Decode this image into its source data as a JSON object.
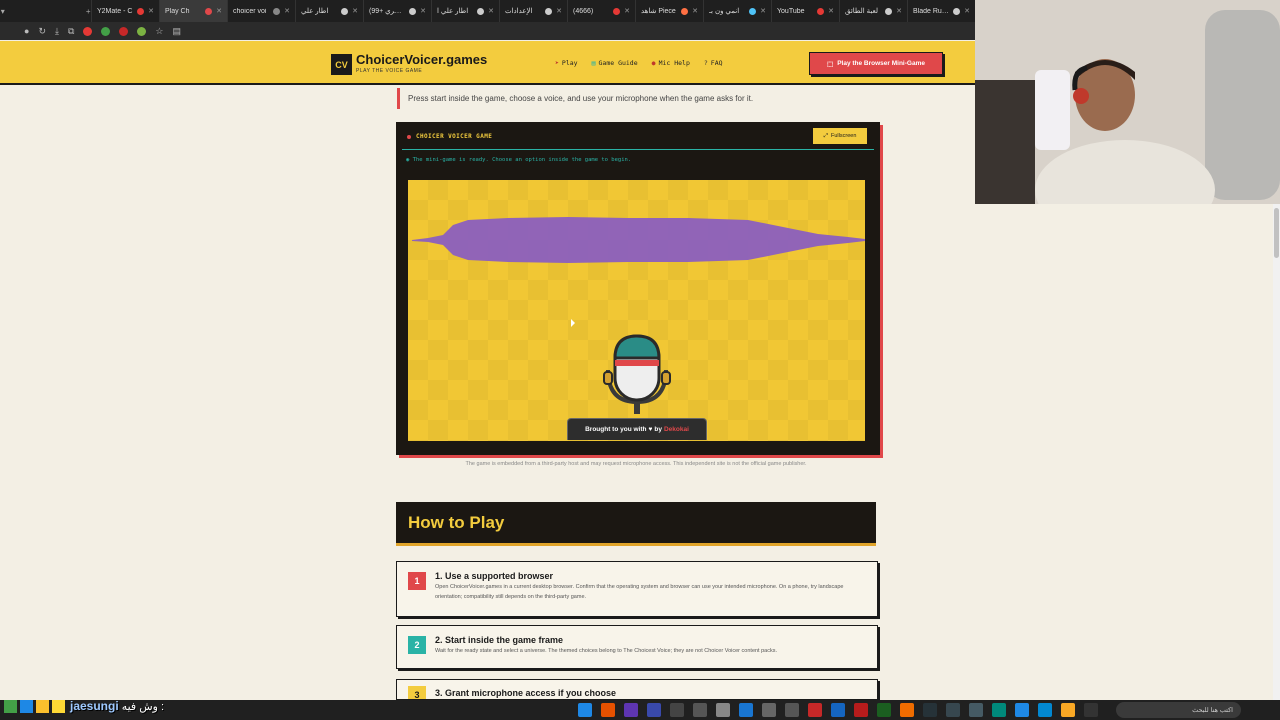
{
  "browser": {
    "tabs": [
      {
        "title": "Y2Mate - C",
        "color": "#e53935",
        "active": false
      },
      {
        "title": "Play Ch",
        "color": "#e0484a",
        "active": true
      },
      {
        "title": "choicer voi",
        "color": "#888888",
        "active": false
      },
      {
        "title": "اطار علي",
        "color": "#cccccc",
        "active": false
      },
      {
        "title": "(شكري +99)",
        "color": "#cccccc",
        "active": false
      },
      {
        "title": "اطار علي ا",
        "color": "#cccccc",
        "active": false
      },
      {
        "title": "الإعدادات",
        "color": "#cccccc",
        "active": false
      },
      {
        "title": "(4666)",
        "color": "#e53935",
        "active": false
      },
      {
        "title": "شاهد Piece",
        "color": "#ff7043",
        "active": false
      },
      {
        "title": "انمي ون بـ",
        "color": "#4fc3f7",
        "active": false
      },
      {
        "title": "YouTube",
        "color": "#e53935",
        "active": false
      },
      {
        "title": "لعبة الطائق",
        "color": "#cccccc",
        "active": false
      },
      {
        "title": "Blade Runn",
        "color": "#cccccc",
        "active": false
      }
    ]
  },
  "header": {
    "logo_mark": "CV",
    "site_title": "ChoicerVoicer.games",
    "tagline": "PLAY THE VOICE GAME",
    "nav": [
      {
        "label": "Play",
        "icon": "play-icon"
      },
      {
        "label": "Game Guide",
        "icon": "book-icon"
      },
      {
        "label": "Mic Help",
        "icon": "mic-icon"
      },
      {
        "label": "FAQ",
        "icon": "help-icon"
      }
    ],
    "cta": "Play the Browser Mini-Game"
  },
  "intro": "Press start inside the game, choose a voice, and use your microphone when the game asks for it.",
  "game": {
    "title": "CHOICER VOICER GAME",
    "fullscreen": "Fullscreen",
    "status": "The mini-game is ready. Choose an option inside the game to begin.",
    "credit_prefix": "Brought to you with",
    "credit_by": "by",
    "credit_brand": "Dekokai",
    "note": "The game is embedded from a third-party host and may request microphone access. This independent site is not the official game publisher."
  },
  "how_to": {
    "heading": "How to Play",
    "steps": [
      {
        "num": "1",
        "title": "1. Use a supported browser",
        "desc": "Open ChoicerVoicer.games in a current desktop browser. Confirm that the operating system and browser can use your intended microphone. On a phone, try landscape orientation; compatibility still depends on the third-party game.",
        "color": "#e0484a"
      },
      {
        "num": "2",
        "title": "2. Start inside the game frame",
        "desc": "Wait for the ready state and select a universe. The themed choices belong to The Choicest Voice; they are not Choicer Voicer content packs.",
        "color": "#2ab3a6"
      },
      {
        "num": "3",
        "title": "3. Grant microphone access if you choose",
        "desc": "",
        "color": "#f3cc3e"
      }
    ]
  },
  "overlay": {
    "streamer": "jaesungi",
    "message": "وش فيه :"
  },
  "taskbar": {
    "search_placeholder": "اكتب هنا للبحث"
  }
}
